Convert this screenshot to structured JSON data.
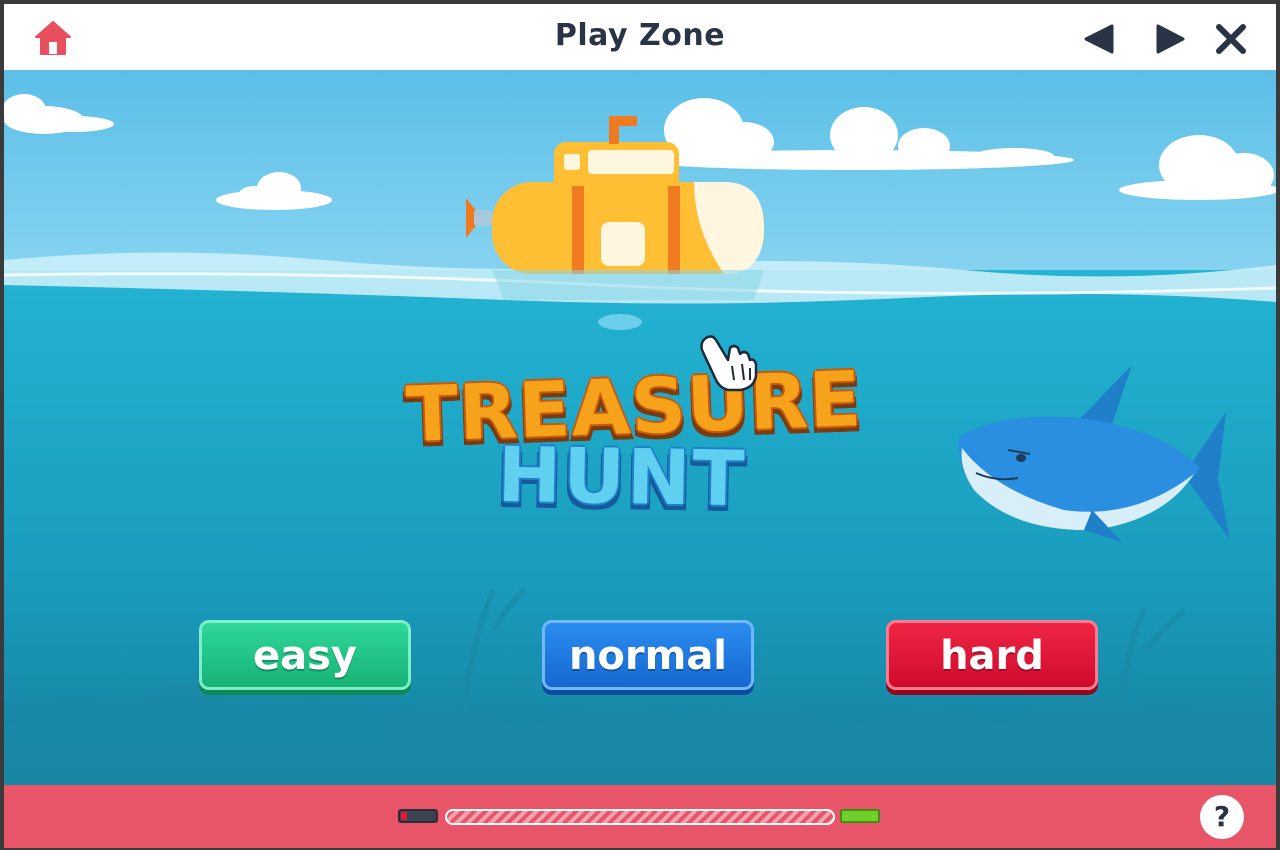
{
  "window": {
    "title": "Play Zone",
    "icons": {
      "home": "home-icon",
      "previous": "triangle-left-icon",
      "next": "triangle-right-icon",
      "close": "close-x-icon"
    }
  },
  "game": {
    "logo_line1": "TREASURE",
    "logo_line2": "HUNT",
    "difficulty_buttons": [
      {
        "label": "easy",
        "color": "#1fc184"
      },
      {
        "label": "normal",
        "color": "#1e7fe3"
      },
      {
        "label": "hard",
        "color": "#e0163a"
      }
    ]
  },
  "footer": {
    "help_label": "?",
    "progress_fraction": 0.0,
    "colors": {
      "footer_bg": "#e85468",
      "battery_low": "#e21b3a",
      "battery_full": "#6fd12a"
    }
  },
  "colors": {
    "sky": "#67c6eb",
    "sea": "#1fa5c6",
    "home_icon": "#e8505f",
    "title_text": "#2b3346"
  }
}
